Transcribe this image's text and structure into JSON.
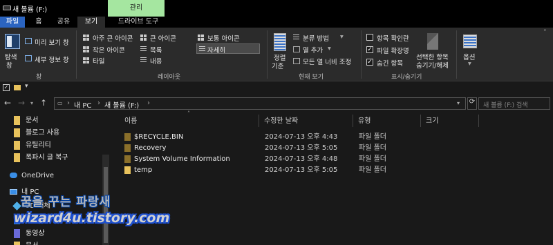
{
  "window": {
    "title": "새 볼륨 (F:)",
    "context_tab": "관리"
  },
  "ribbon_tabs": {
    "file": "파일",
    "home": "홈",
    "share": "공유",
    "view": "보기",
    "drive_tools": "드라이브 도구"
  },
  "ribbon": {
    "panes": {
      "nav_pane": "탐색\n창",
      "nav_pane_line1": "탐색",
      "nav_pane_line2": "창",
      "preview": "미리 보기 창",
      "details": "세부 정보 창",
      "label": "창"
    },
    "layout": {
      "extra_large": "아주 큰 아이콘",
      "large": "큰 아이콘",
      "medium": "보통 아이콘",
      "small": "작은 아이콘",
      "list": "목록",
      "details": "자세히",
      "tiles": "타일",
      "content": "내용",
      "label": "레이아웃"
    },
    "current_view": {
      "sort_line1": "정렬",
      "sort_line2": "기준",
      "group_by": "분류 방법",
      "add_columns": "열 추가",
      "size_columns": "모든 열 너비 조정",
      "label": "현재 보기"
    },
    "show_hide": {
      "item_checkboxes": "항목 확인란",
      "file_extensions": "파일 확장명",
      "hidden_items": "숨긴 항목",
      "hide_selected_line1": "선택한 항목",
      "hide_selected_line2": "숨기기/해제",
      "label": "표시/숨기기",
      "item_checkboxes_checked": false,
      "file_extensions_checked": true,
      "hidden_items_checked": true
    },
    "options": "옵션"
  },
  "address": {
    "crumb1": "내 PC",
    "crumb2": "새 볼륨 (F:)",
    "search_placeholder": "새 볼륨 (F:) 검색"
  },
  "nav_pane": {
    "items": [
      {
        "label": "문서",
        "icon": "folder-icon"
      },
      {
        "label": "블로그 사용",
        "icon": "folder-icon"
      },
      {
        "label": "유틸리티",
        "icon": "folder-icon"
      },
      {
        "label": "폭파시 글 복구",
        "icon": "folder-icon"
      },
      {
        "label": "OneDrive",
        "icon": "cloud-icon"
      },
      {
        "label": "내 PC",
        "icon": "pc-icon"
      },
      {
        "label": "3D 개체",
        "icon": "cube-icon"
      },
      {
        "label": "다운로드",
        "icon": "download-icon"
      },
      {
        "label": "동영상",
        "icon": "video-icon"
      },
      {
        "label": "문서",
        "icon": "folder-icon"
      }
    ]
  },
  "columns": {
    "name": "이름",
    "modified": "수정한 날짜",
    "type": "유형",
    "size": "크기"
  },
  "files": [
    {
      "name": "$RECYCLE.BIN",
      "modified": "2024-07-13 오후 4:43",
      "type": "파일 폴더",
      "hidden": true
    },
    {
      "name": "Recovery",
      "modified": "2024-07-13 오후 5:05",
      "type": "파일 폴더",
      "hidden": true
    },
    {
      "name": "System Volume Information",
      "modified": "2024-07-13 오후 4:48",
      "type": "파일 폴더",
      "hidden": true
    },
    {
      "name": "temp",
      "modified": "2024-07-13 오후 5:05",
      "type": "파일 폴더",
      "hidden": false
    }
  ],
  "watermark": {
    "line1": "꿈을 꾸는 파랑새",
    "line2": "wizard4u.tistory.com"
  },
  "colors": {
    "accent": "#2b64c0",
    "context_tab": "#a5e6a0",
    "folder": "#e8c25c",
    "background": "#191919"
  }
}
